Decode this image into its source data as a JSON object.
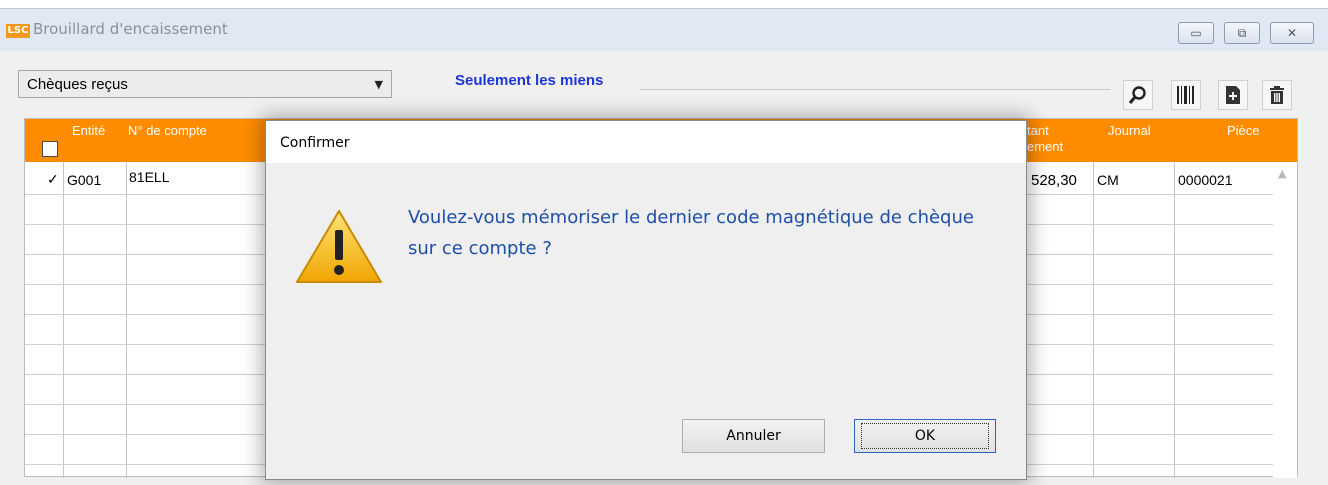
{
  "window": {
    "logo": "LSC",
    "title": "Brouillard d'encaissement",
    "controls": {
      "minimize": "▭",
      "maximize": "⧉",
      "close": "✕"
    }
  },
  "toolbar": {
    "combo_value": "Chèques reçus",
    "only_mine_label": "Seulement les miens",
    "icons": [
      "search-icon",
      "barcode-icon",
      "add-document-icon",
      "delete-icon"
    ]
  },
  "grid": {
    "headers": {
      "entite": "Entité",
      "compte": "N° de compte",
      "montant_1": "tant",
      "montant_2": "ement",
      "journal": "Journal",
      "piece": "Pièce"
    },
    "rows": [
      {
        "check": "✓",
        "entite": "G001",
        "compte": "81ELL",
        "montant": "528,30",
        "journal": "CM",
        "piece": "0000021"
      }
    ]
  },
  "dialog": {
    "title": "Confirmer",
    "message": "Voulez-vous mémoriser le dernier code magnétique de chèque sur ce compte ?",
    "cancel_label": "Annuler",
    "ok_label": "OK"
  },
  "colors": {
    "header_orange": "#ff8c00",
    "link_blue": "#1f36d6",
    "message_blue": "#1d4fa8",
    "warning_yellow": "#f5c518"
  }
}
